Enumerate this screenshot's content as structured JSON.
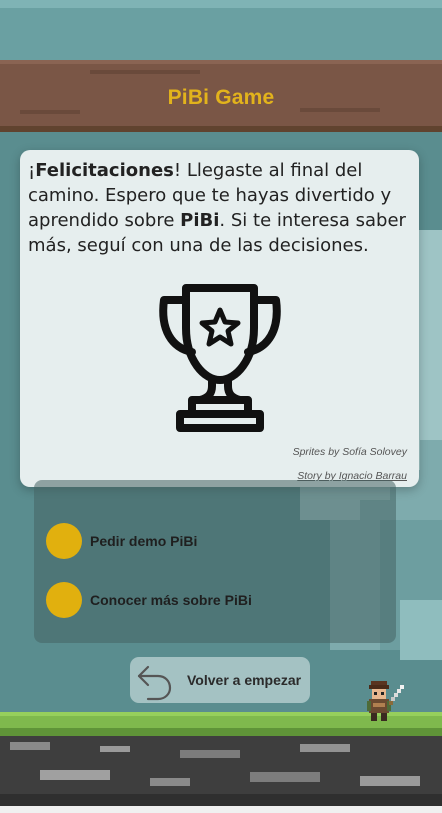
{
  "header": {
    "title": "PiBi Game"
  },
  "card": {
    "text_start": "¡",
    "text_bold1": "Felicitaciones",
    "text_mid": "! Llegaste al final del camino. Espero que te hayas divertido y aprendido sobre ",
    "text_bold2": "PiBi",
    "text_end": ". Si te interesa saber más, seguí con una de las decisiones.",
    "sprites_credit": "Sprites by Sofía Solovey",
    "story_credit": "Story by Ignacio Barrau",
    "image_icon": "trophy-icon"
  },
  "options": [
    {
      "label": "Pedir demo PiBi"
    },
    {
      "label": "Conocer más sobre PiBi"
    }
  ],
  "restart": {
    "label": "Volver a empezar",
    "icon": "undo-arrow-icon"
  },
  "colors": {
    "accent_gold": "#e1b00e",
    "header_brown": "#7a5646",
    "background_teal": "#5e9294",
    "grass_green": "#7fb94d"
  }
}
